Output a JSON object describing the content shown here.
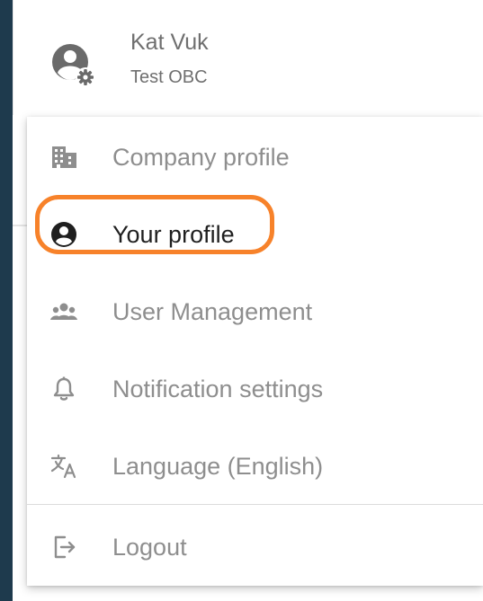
{
  "user": {
    "name": "Kat Vuk",
    "organization": "Test OBC"
  },
  "menu": {
    "items": [
      {
        "label": "Company profile",
        "icon": "building-icon",
        "active": false
      },
      {
        "label": "Your profile",
        "icon": "user-circle-icon",
        "active": true
      },
      {
        "label": "User Management",
        "icon": "users-icon",
        "active": false
      },
      {
        "label": "Notification settings",
        "icon": "bell-icon",
        "active": false
      },
      {
        "label": "Language (English)",
        "icon": "translate-icon",
        "active": false
      }
    ],
    "logout": {
      "label": "Logout",
      "icon": "logout-icon"
    }
  },
  "colors": {
    "highlight": "#f7822a",
    "rail": "#1e3a4d",
    "inactive_text": "#8e8e8e",
    "active_text": "#1f1f1f"
  }
}
